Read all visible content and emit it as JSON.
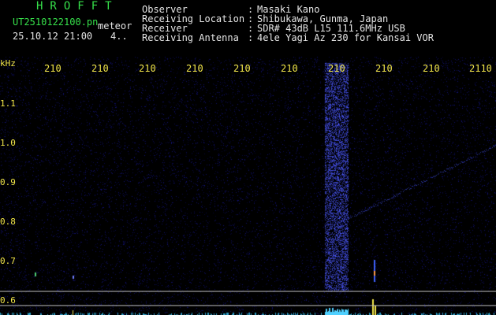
{
  "header": {
    "logo": "HROFFT",
    "filename": "UT2510122100.pn",
    "mode": "meteor",
    "datetime": "25.10.12 21:00",
    "count": "4.."
  },
  "info": [
    {
      "label": "Observer",
      "value": "Masaki Kano"
    },
    {
      "label": "Receiving Location",
      "value": "Shibukawa, Gunma, Japan"
    },
    {
      "label": "Receiver",
      "value": "SDR# 43dB L15 111.6MHz USB"
    },
    {
      "label": "Receiving Antenna",
      "value": "4ele Yagi Az 230 for Kansai VOR"
    }
  ],
  "axis": {
    "unit": "kHz",
    "time_ticks": [
      "210",
      "210",
      "210",
      "210",
      "210",
      "210",
      "210",
      "210",
      "210",
      "2110"
    ],
    "freq_ticks": [
      "1.1",
      "1.0",
      "0.9",
      "0.8",
      "0.7",
      "0.6"
    ]
  },
  "colors": {
    "background": "#000000",
    "noise_dark": "#0a0a3a",
    "signal_blue": "#2b3cff",
    "signal_bright": "#6f7dff",
    "tick_yellow": "#f2e64a",
    "header_green": "#36e04a"
  }
}
